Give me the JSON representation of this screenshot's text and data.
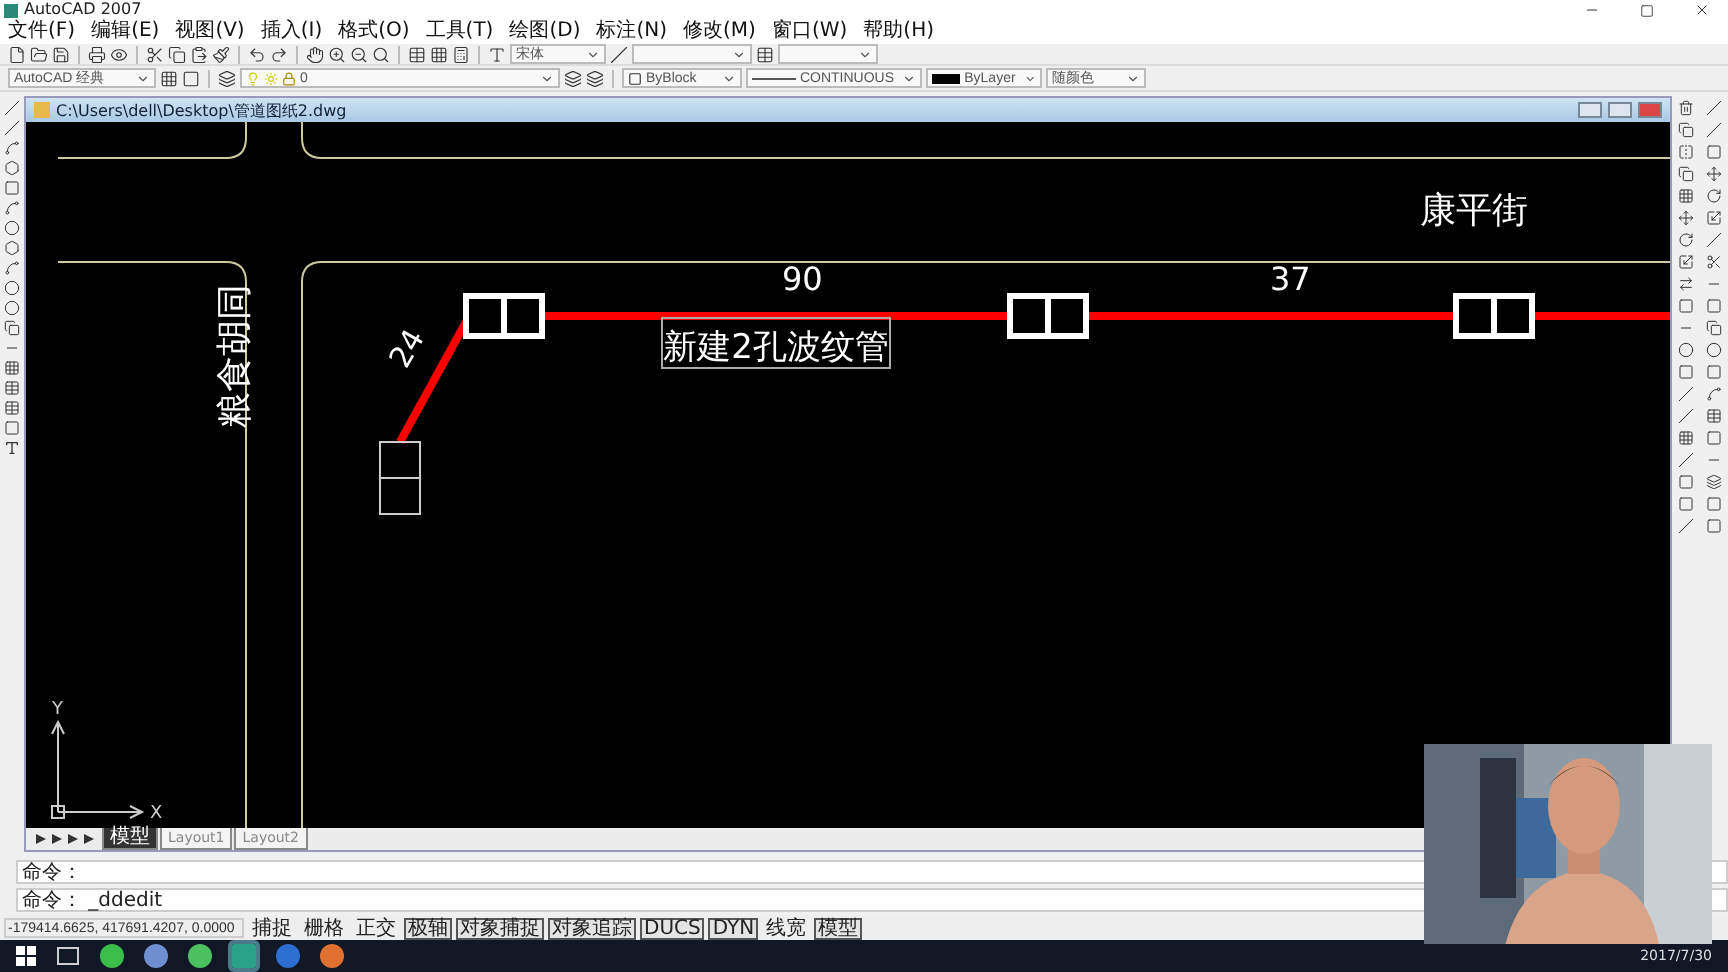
{
  "window": {
    "title": "AutoCAD 2007"
  },
  "menu": [
    "文件(F)",
    "编辑(E)",
    "视图(V)",
    "插入(I)",
    "格式(O)",
    "工具(T)",
    "绘图(D)",
    "标注(N)",
    "修改(M)",
    "窗口(W)",
    "帮助(H)"
  ],
  "toolbar": {
    "font": "宋体",
    "workspace": "AutoCAD 经典",
    "layer": "0",
    "object_color": "ByBlock",
    "linetype": "CONTINUOUS",
    "lineweight": "ByLayer",
    "plot_style": "随颜色"
  },
  "document": {
    "title": "C:\\Users\\dell\\Desktop\\管道图纸2.dwg"
  },
  "drawing": {
    "labels": [
      {
        "kind": "street",
        "text": "康平街"
      },
      {
        "kind": "street_vertical",
        "text": "粮食胡同"
      },
      {
        "kind": "length",
        "text": "90"
      },
      {
        "kind": "length",
        "text": "37"
      },
      {
        "kind": "length_rotated",
        "text": "24"
      },
      {
        "kind": "boxed",
        "text": "新建2孔波纹管"
      }
    ],
    "axes": {
      "x": "X",
      "y": "Y"
    }
  },
  "layout_tabs": [
    {
      "label": "模型",
      "selected": true
    },
    {
      "label": "Layout1",
      "selected": false
    },
    {
      "label": "Layout2",
      "selected": false
    }
  ],
  "command_lines": [
    "命令：",
    "命令： _ddedit"
  ],
  "status_bar": {
    "coordinates": "-179414.6625, 417691.4207, 0.0000",
    "toggles": [
      {
        "label": "捕捉",
        "on": false
      },
      {
        "label": "栅格",
        "on": false
      },
      {
        "label": "正交",
        "on": false
      },
      {
        "label": "极轴",
        "on": true
      },
      {
        "label": "对象捕捉",
        "on": true
      },
      {
        "label": "对象追踪",
        "on": true
      },
      {
        "label": "DUCS",
        "on": true
      },
      {
        "label": "DYN",
        "on": true
      },
      {
        "label": "线宽",
        "on": false
      },
      {
        "label": "模型",
        "on": true
      }
    ]
  },
  "taskbar": {
    "date": "2017/7/30"
  },
  "webcam": {
    "kind": "picture"
  }
}
